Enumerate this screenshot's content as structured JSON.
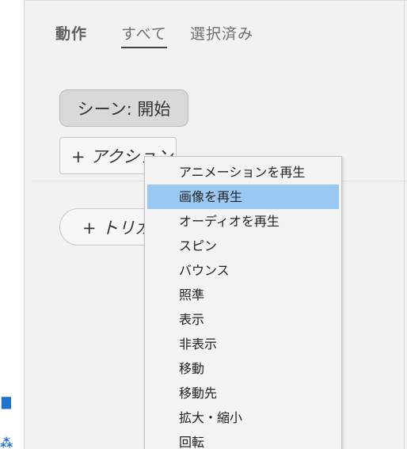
{
  "tabs": [
    {
      "label": "動作"
    },
    {
      "label": "すべて"
    },
    {
      "label": "選択済み"
    }
  ],
  "scene": {
    "label": "シーン: 開始"
  },
  "buttons": {
    "action": "+ アクション",
    "trigger": "+ トリガー"
  },
  "menu": {
    "highlighted_index": 1,
    "items": [
      {
        "label": "アニメーションを再生"
      },
      {
        "label": "画像を再生"
      },
      {
        "label": "オーディオを再生"
      },
      {
        "label": "スピン"
      },
      {
        "label": "バウンス"
      },
      {
        "label": "照準"
      },
      {
        "label": "表示"
      },
      {
        "label": "非表示"
      },
      {
        "label": "移動"
      },
      {
        "label": "移動先"
      },
      {
        "label": "拡大・縮小"
      },
      {
        "label": "回転"
      }
    ]
  },
  "colors": {
    "highlight": "#99c9f3",
    "accent": "#1e73d2",
    "background": "#f2f2f2"
  }
}
